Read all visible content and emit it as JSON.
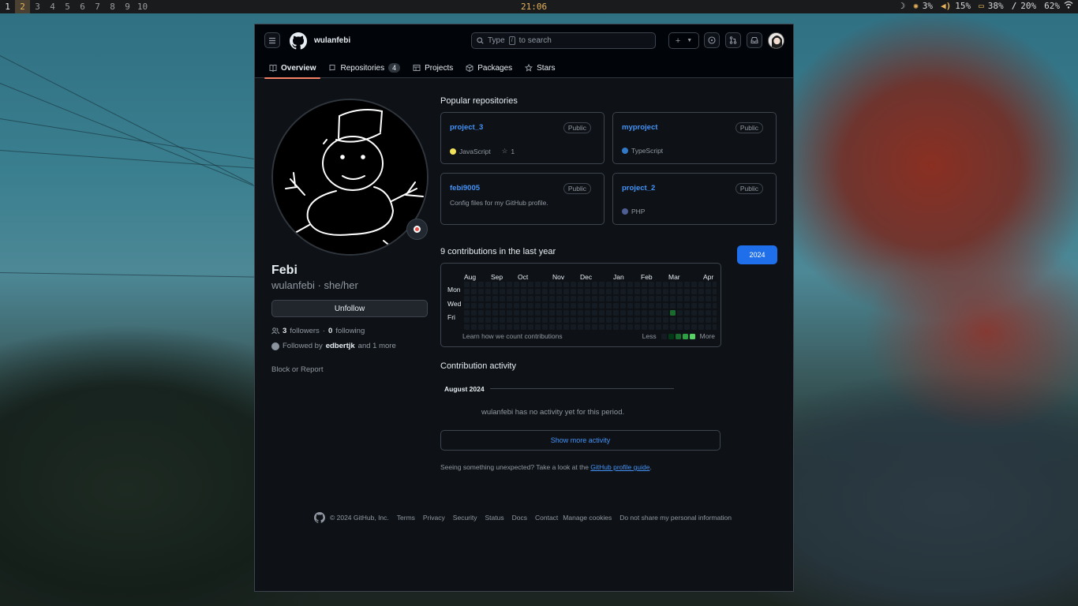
{
  "statusbar": {
    "workspaces": [
      "1",
      "2",
      "3",
      "4",
      "5",
      "6",
      "7",
      "8",
      "9",
      "10"
    ],
    "active_workspace": "2",
    "clock": "21:06",
    "tray": {
      "brightness": "3%",
      "volume": "15%",
      "battery": "38%",
      "disk": "20%",
      "wifi": "62%"
    }
  },
  "header": {
    "username": "wulanfebi",
    "search_placeholder_before": "Type",
    "search_key": "/",
    "search_placeholder_after": "to search",
    "tabs": [
      {
        "label": "Overview",
        "icon": "book-icon"
      },
      {
        "label": "Repositories",
        "count": "4",
        "icon": "repo-icon"
      },
      {
        "label": "Projects",
        "icon": "table-icon"
      },
      {
        "label": "Packages",
        "icon": "package-icon"
      },
      {
        "label": "Stars",
        "icon": "star-icon"
      }
    ]
  },
  "profile": {
    "name": "Febi",
    "login_line": "wulanfebi · she/her",
    "unfollow_label": "Unfollow",
    "followers_count": "3",
    "followers_label": "followers",
    "separator": "·",
    "following_count": "0",
    "following_label": "following",
    "followed_by_prefix": "Followed by",
    "followed_by_user": "edbertjk",
    "followed_by_suffix": "and 1 more",
    "block_report": "Block or Report"
  },
  "popular": {
    "title": "Popular repositories",
    "repos": [
      {
        "name": "project_3",
        "visibility": "Public",
        "language": "JavaScript",
        "lang_color": "#f1e05a",
        "stars": "1"
      },
      {
        "name": "myproject",
        "visibility": "Public",
        "language": "TypeScript",
        "lang_color": "#3178c6"
      },
      {
        "name": "febi9005",
        "visibility": "Public",
        "description": "Config files for my GitHub profile."
      },
      {
        "name": "project_2",
        "visibility": "Public",
        "language": "PHP",
        "lang_color": "#4F5D95"
      }
    ]
  },
  "contributions": {
    "title": "9 contributions in the last year",
    "year": "2024",
    "months": [
      "Aug",
      "Sep",
      "Oct",
      "Nov",
      "Dec",
      "Jan",
      "Feb",
      "Mar",
      "Apr"
    ],
    "days": [
      "Mon",
      "Wed",
      "Fri"
    ],
    "learn": "Learn how we count contributions",
    "less": "Less",
    "more": "More",
    "active_cell": {
      "week": 29,
      "day": 4,
      "level": 2
    },
    "colors": {
      "empty": "#151b23",
      "l1": "#033a16",
      "l2": "#196c2e",
      "l3": "#2ea043",
      "l4": "#56d364"
    }
  },
  "activity": {
    "title": "Contribution activity",
    "month": "August 2024",
    "empty_text": "wulanfebi has no activity yet for this period.",
    "show_more": "Show more activity",
    "unexpected_prefix": "Seeing something unexpected? Take a look at the",
    "guide_link": "GitHub profile guide",
    "unexpected_suffix": "."
  },
  "footer": {
    "copyright": "© 2024 GitHub, Inc.",
    "links": [
      "Terms",
      "Privacy",
      "Security",
      "Status",
      "Docs",
      "Contact",
      "Manage cookies",
      "Do not share my personal information"
    ]
  }
}
